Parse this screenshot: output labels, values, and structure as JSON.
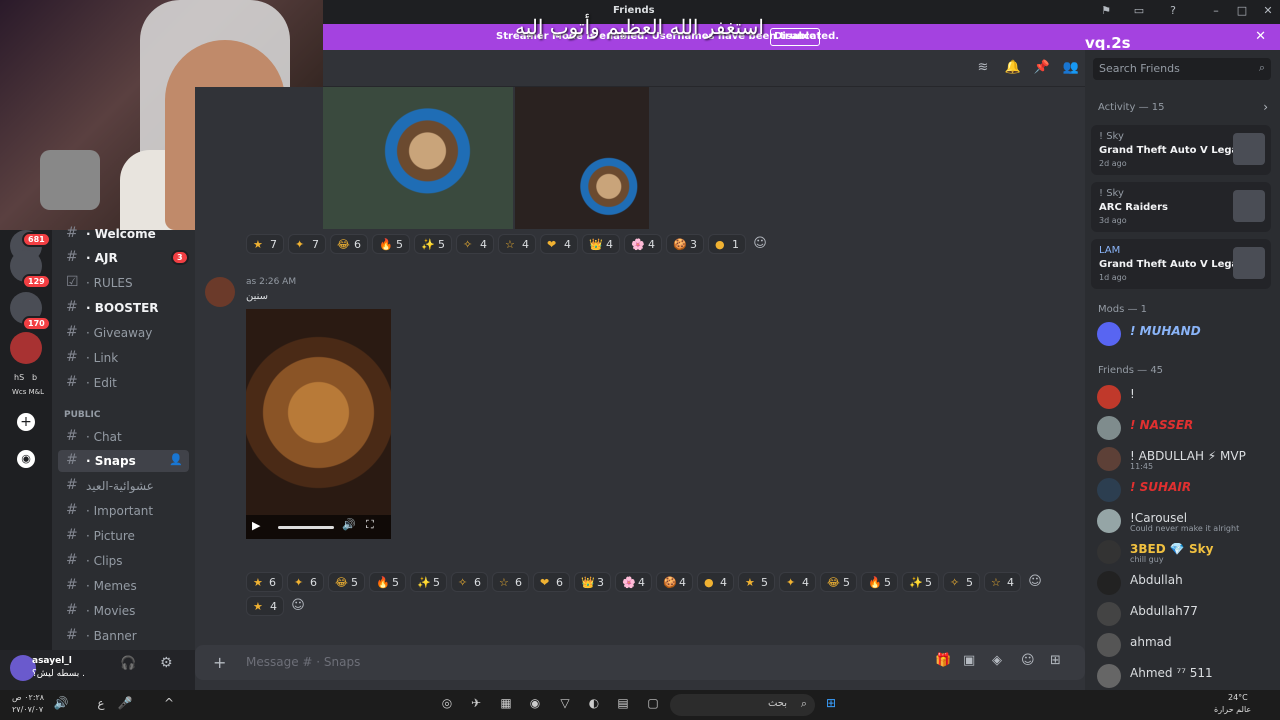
{
  "window": {
    "title": "Friends"
  },
  "streamer": {
    "message": "Streamer Mode is enabled. Usernames have been truncated.",
    "disable": "Disable"
  },
  "overlay": {
    "arabic": "استغفر الله العظيم وأتوب إليه",
    "tiktok": "vq.2s"
  },
  "servers": [
    {
      "badge": "681"
    },
    {
      "badge": "129"
    },
    {
      "badge": "170"
    }
  ],
  "server_labels": {
    "hs": "hS",
    "b": "b",
    "wcs": "Wcs M&L"
  },
  "channels": [
    {
      "name": "· Welcome",
      "bold": true
    },
    {
      "name": "· AJR",
      "bold": true,
      "badge": "3"
    },
    {
      "name": "· RULES"
    },
    {
      "name": "· BOOSTER",
      "bold": true
    },
    {
      "name": "· Giveaway"
    },
    {
      "name": "· Link"
    },
    {
      "name": "· Edit"
    }
  ],
  "public_label": "PUBLIC",
  "public_channels": [
    {
      "name": "· Chat"
    },
    {
      "name": "· Snaps",
      "active": true
    },
    {
      "name": "عشوائية-العيد"
    },
    {
      "name": "· Important"
    },
    {
      "name": "· Picture"
    },
    {
      "name": "· Clips"
    },
    {
      "name": "· Memes"
    },
    {
      "name": "· Movies"
    },
    {
      "name": "· Banner"
    }
  ],
  "user_panel": {
    "name": "asayel_l",
    "status": "بسطه ليش؟ ."
  },
  "reactions_top": [
    "7",
    "7",
    "6",
    "5",
    "5",
    "4",
    "4",
    "4",
    "4",
    "4",
    "3",
    "1"
  ],
  "message": {
    "author": "as",
    "time": "2:26 AM",
    "text": "سنين"
  },
  "reactions_bottom": [
    "6",
    "6",
    "5",
    "5",
    "5",
    "6",
    "6",
    "6",
    "3",
    "4",
    "4",
    "4",
    "5",
    "4",
    "5",
    "5",
    "5",
    "5",
    "4"
  ],
  "reactions_bottom2": [
    "4"
  ],
  "composer": {
    "placeholder": "Message # · Snaps"
  },
  "search": {
    "placeholder": "Search Friends"
  },
  "activity": {
    "label": "Activity — 15"
  },
  "activities": [
    {
      "user": "! Sky",
      "game": "Grand Theft Auto V Legacy",
      "time": "2d ago"
    },
    {
      "user": "! Sky",
      "game": "ARC Raiders",
      "time": "3d ago"
    },
    {
      "user": "LAM",
      "game": "Grand Theft Auto V Legacy",
      "time": "1d ago"
    }
  ],
  "mods": {
    "label": "Mods — 1",
    "items": [
      {
        "name": "! MUHAND"
      }
    ]
  },
  "friends": {
    "label": "Friends — 45",
    "items": [
      {
        "name": "!",
        "sub": ""
      },
      {
        "name": "! NASSER",
        "sub": ""
      },
      {
        "name": "! ABDULLAH ⚡ MVP",
        "sub": "11:45"
      },
      {
        "name": "! SUHAIR",
        "sub": ""
      },
      {
        "name": "!Carousel",
        "sub": "Could never make it alright"
      },
      {
        "name": "3BED 💎 Sky",
        "sub": "chill guy"
      },
      {
        "name": "Abdullah",
        "sub": ""
      },
      {
        "name": "Abdullah77",
        "sub": ""
      },
      {
        "name": "ahmad",
        "sub": ""
      },
      {
        "name": "Ahmed ⁷⁷ 511",
        "sub": ""
      }
    ]
  },
  "taskbar": {
    "search": "بحث",
    "weather": "24°C",
    "weather_text": "عالم حرارة",
    "time": "٠٢:٢٨ ص",
    "date": "٢٧/٠٧/٠٧"
  }
}
